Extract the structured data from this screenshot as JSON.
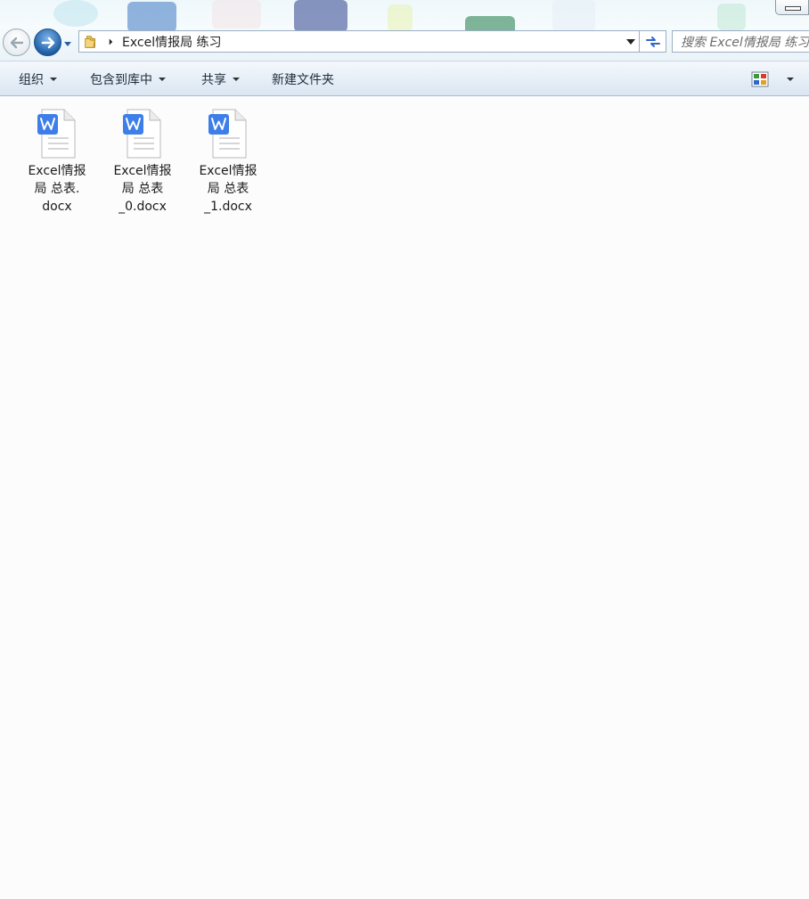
{
  "window": {
    "colors": {
      "accent": "#2f66c9",
      "address_border": "#9bafc4",
      "toolbar_bg": "#e7eff7",
      "content_bg": "#fcfcfc"
    }
  },
  "address_bar": {
    "path": [
      "Excel情报局 练习"
    ],
    "search_placeholder": "搜索 Excel情报局 练习"
  },
  "toolbar": {
    "organize": "组织",
    "include_in_library": "包含到库中",
    "share": "共享",
    "new_folder": "新建文件夹"
  },
  "files": [
    {
      "name": "Excel情报\n局 总表.\ndocx",
      "icon": "wps-word-doc-icon"
    },
    {
      "name": "Excel情报\n局 总表\n_0.docx",
      "icon": "wps-word-doc-icon"
    },
    {
      "name": "Excel情报\n局 总表\n_1.docx",
      "icon": "wps-word-doc-icon"
    }
  ]
}
